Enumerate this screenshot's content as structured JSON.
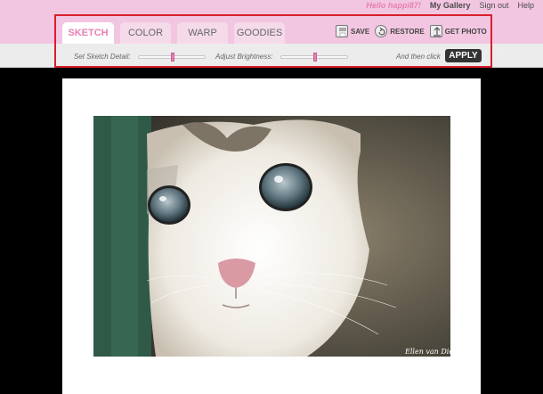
{
  "header": {
    "greeting": "Hello happi87!",
    "links": [
      "My Gallery",
      "Sign out",
      "Help"
    ]
  },
  "tabs": [
    "SKETCH",
    "COLOR",
    "WARP",
    "GOODIES"
  ],
  "active_tab": "SKETCH",
  "actions": {
    "save": "SAVE",
    "restore": "RESTORE",
    "get_photo": "GET PHOTO"
  },
  "controls": {
    "detail_label": "Set Sketch Detail:",
    "brightness_label": "Adjust Brightness:",
    "then_click": "And then click",
    "apply": "APPLY",
    "detail_value": 0.5,
    "brightness_value": 0.5
  },
  "photo": {
    "subject": "kitten",
    "signature": "Ellen van Dielen"
  },
  "colors": {
    "pink_bar": "#f2c6e0",
    "accent": "#e880b4",
    "highlight_border": "#d8202c"
  }
}
